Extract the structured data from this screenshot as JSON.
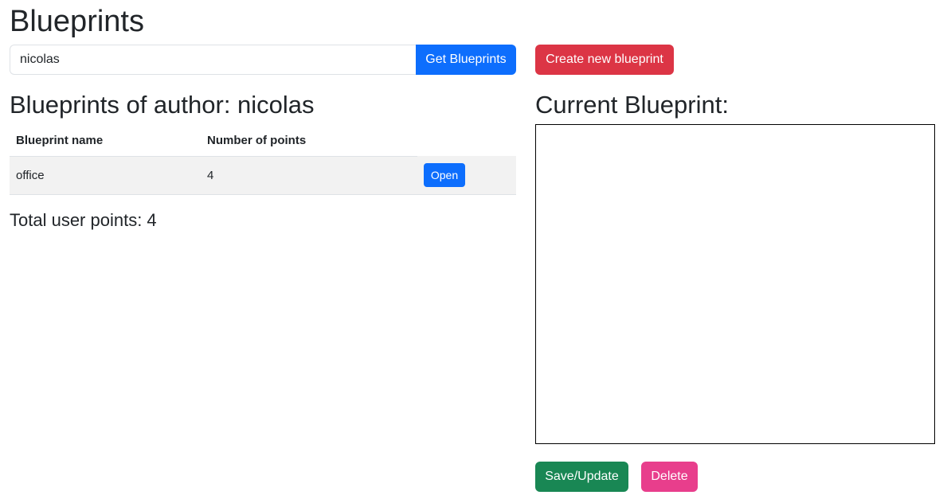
{
  "header": {
    "title": "Blueprints"
  },
  "search": {
    "value": "nicolas",
    "placeholder": "",
    "button_label": "Get Blueprints"
  },
  "create_button_label": "Create new blueprint",
  "author_heading": "Blueprints of author: nicolas",
  "table": {
    "columns": [
      "Blueprint name",
      "Number of points",
      ""
    ],
    "rows": [
      {
        "name": "office",
        "points": "4",
        "action_label": "Open"
      }
    ]
  },
  "total_points": "Total user points: 4",
  "current_blueprint": {
    "heading": "Current Blueprint:"
  },
  "actions": {
    "save_label": "Save/Update",
    "delete_label": "Delete"
  },
  "colors": {
    "primary": "#0d6efd",
    "danger": "#dc3545",
    "success": "#198754",
    "pink": "#e83e8c",
    "row_bg": "#f2f2f2"
  }
}
